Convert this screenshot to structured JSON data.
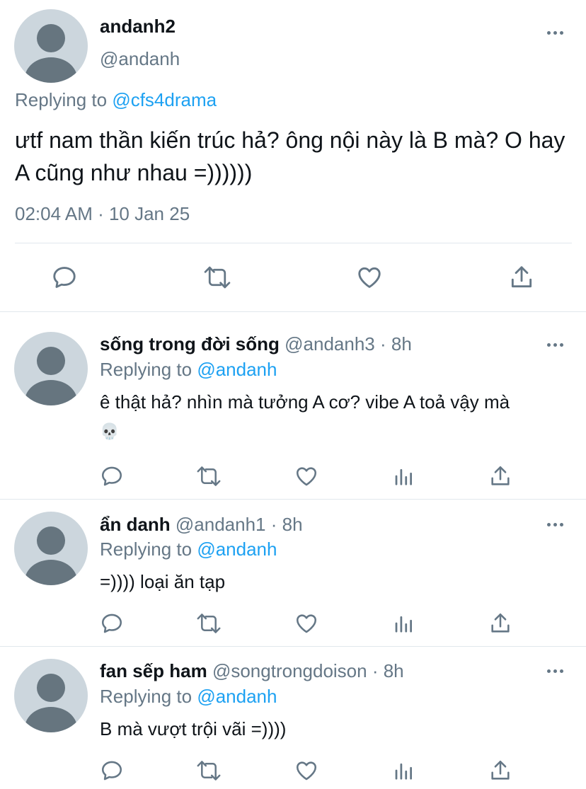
{
  "main_tweet": {
    "display_name": "andanh2",
    "handle": "@andanh",
    "replying_prefix": "Replying to",
    "replying_handle": "@cfs4drama",
    "text": "ưtf nam thần kiến trúc hả? ông nội này là B mà? O hay A cũng như nhau =))))))",
    "timestamp": "02:04 AM · 10 Jan 25",
    "actions": [
      "reply-icon",
      "retweet-icon",
      "like-icon",
      "share-icon"
    ]
  },
  "replies": [
    {
      "display_name": "sống trong đời sống",
      "handle": "@andanh3",
      "time": "· 8h",
      "replying_prefix": "Replying to",
      "replying_handle": "@andanh",
      "text": "ê thật hả? nhìn mà tưởng A cơ? vibe A toả vậy mà",
      "emoji": "💀"
    },
    {
      "display_name": "ẩn danh",
      "handle": "@andanh1",
      "time": "· 8h",
      "replying_prefix": "Replying to",
      "replying_handle": "@andanh",
      "text": "=)))) loại ăn tạp"
    },
    {
      "display_name": "fan sếp ham",
      "handle": "@songtrongdoison",
      "time": "· 8h",
      "replying_prefix": "Replying to",
      "replying_handle": "@andanh",
      "text": "B mà vượt trội vãi =))))"
    }
  ],
  "icons": {
    "reply": "reply-icon",
    "retweet": "retweet-icon",
    "like": "heart-icon",
    "analytics": "analytics-icon",
    "share": "share-icon",
    "more": "more-icon"
  },
  "colors": {
    "link": "#1da1f2",
    "secondary_text": "#657786",
    "avatar_bg": "#ccd6dd",
    "avatar_fg": "#66757f",
    "divider": "#e1e8ed"
  }
}
